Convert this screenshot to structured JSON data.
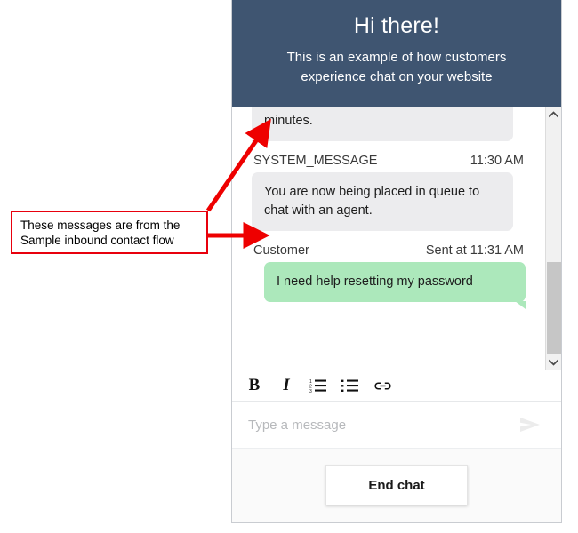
{
  "annotation": {
    "text": "These messages are from the\nSample inbound contact flow",
    "border_color": "#e8000d",
    "arrow_color": "#ee0000"
  },
  "chat_widget": {
    "header": {
      "title": "Hi there!",
      "subtitle": "This is an example of how customers experience chat on your website",
      "background_color": "#3f5571",
      "text_color": "#ffffff"
    },
    "transcript": {
      "messages": [
        {
          "sender": "",
          "timestamp": "",
          "text": "minutes.",
          "side": "agent",
          "clipped": true,
          "bubble_color": "#ececee"
        },
        {
          "sender": "SYSTEM_MESSAGE",
          "timestamp": "11:30 AM",
          "text": "You are now being placed in queue to chat with an agent.",
          "side": "agent",
          "clipped": false,
          "bubble_color": "#ececee"
        },
        {
          "sender": "Customer",
          "timestamp": "Sent at  11:31 AM",
          "text": "I need help resetting my password",
          "side": "customer",
          "clipped": false,
          "bubble_color": "#ace8bb"
        }
      ],
      "scrollbar": {
        "up_icon": "chevron-up-icon",
        "down_icon": "chevron-down-icon",
        "thumb_color": "#c6c6c6",
        "track_color": "#f1f1f1"
      }
    },
    "format_toolbar": {
      "buttons": [
        {
          "name": "bold-icon",
          "label": "B"
        },
        {
          "name": "italic-icon",
          "label": "I"
        },
        {
          "name": "ordered-list-icon",
          "label": ""
        },
        {
          "name": "unordered-list-icon",
          "label": ""
        },
        {
          "name": "link-icon",
          "label": ""
        }
      ]
    },
    "composer": {
      "placeholder": "Type a message",
      "value": "",
      "send_icon": "send-arrow-icon"
    },
    "footer": {
      "end_chat_label": "End chat"
    }
  }
}
